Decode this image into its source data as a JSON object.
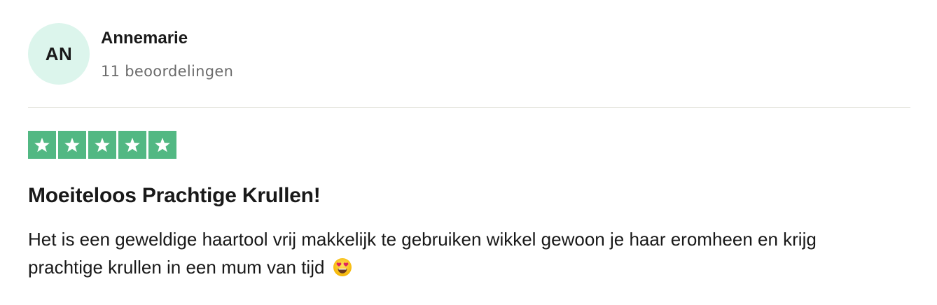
{
  "review": {
    "consumer": {
      "initials": "AN",
      "name": "Annemarie",
      "reviews_count": "11 beoordelingen",
      "avatar_color": "#dcf5ec"
    },
    "rating": {
      "stars": 5,
      "max_stars": 5,
      "star_color": "#52b883",
      "icon": "star-icon"
    },
    "title": "Moeiteloos Prachtige Krullen!",
    "body": "Het is een geweldige haartool vrij makkelijk te gebruiken wikkel gewoon je haar eromheen en krijg prachtige krullen in een mum van tijd",
    "body_emoji": "smiling-face-with-heart-eyes-icon"
  }
}
